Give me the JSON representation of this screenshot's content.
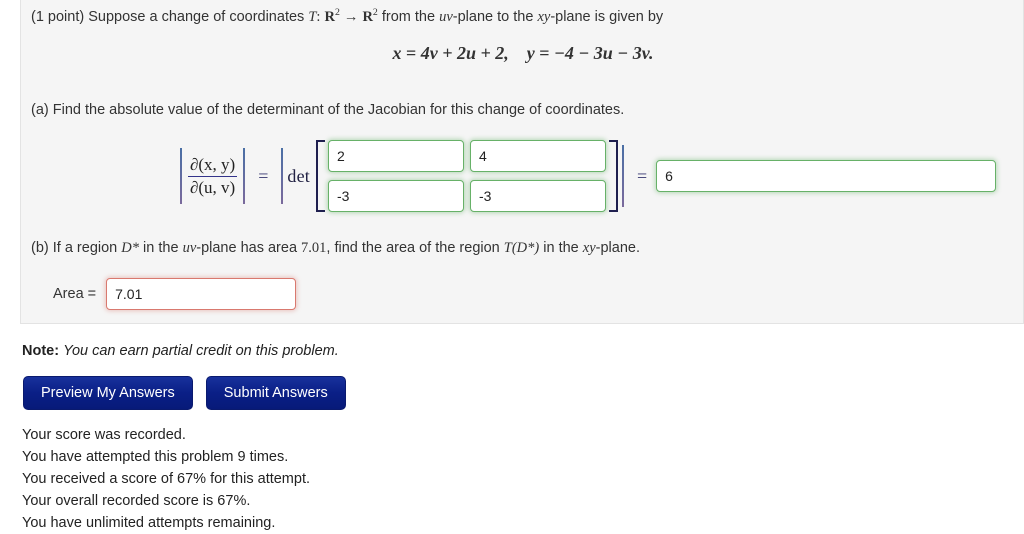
{
  "problem": {
    "points_label": "(1 point)",
    "statement_prefix": "Suppose a change of coordinates",
    "transform_symbol": "T",
    "colon": ":",
    "domain_space": "R",
    "domain_exp": "2",
    "arrow": "→",
    "codomain_space": "R",
    "codomain_exp": "2",
    "statement_mid": "from the",
    "uv_plane": "uv",
    "plane_suffix_1": "-plane to the",
    "xy_plane": "xy",
    "plane_suffix_2": "-plane is given by",
    "display_equation": "x = 4v + 2u + 2,   y = −4 − 3u − 3v.",
    "equation_parts": {
      "x": "x",
      "eq1": "=",
      "x_rhs": "4v + 2u + 2,",
      "y": "y",
      "eq2": "=",
      "y_rhs": "−4 − 3u − 3v."
    }
  },
  "part_a": {
    "label": "(a) Find the absolute value of the determinant of the Jacobian for this change of coordinates.",
    "jacobian": {
      "numerator": "∂(x, y)",
      "denominator": "∂(u, v)",
      "equals_1": "=",
      "det_label": "det",
      "equals_2": "="
    },
    "matrix": {
      "values": [
        "2",
        "4",
        "-3",
        "-3"
      ],
      "states": [
        "correct",
        "correct",
        "correct",
        "correct"
      ]
    },
    "result": {
      "value": "6",
      "state": "correct"
    }
  },
  "part_b": {
    "label_pre": "(b) If a region",
    "d_star": "D*",
    "label_mid1": "in the",
    "uv_plane": "uv",
    "label_mid2": "-plane has area",
    "area_value_text": "7.01",
    "label_mid3": ", find the area of the region",
    "t_d_star": "T(D*)",
    "label_mid4": "in the",
    "xy_plane": "xy",
    "label_end": "-plane.",
    "area_label": "Area =",
    "area_input": {
      "value": "7.01",
      "state": "incorrect"
    }
  },
  "note": {
    "bold_prefix": "Note:",
    "italic_text": "You can earn partial credit on this problem."
  },
  "buttons": {
    "preview": "Preview My Answers",
    "submit": "Submit Answers"
  },
  "score_messages": [
    "Your score was recorded.",
    "You have attempted this problem 9 times.",
    "You received a score of 67% for this attempt.",
    "Your overall recorded score is 67%.",
    "You have unlimited attempts remaining."
  ],
  "colors": {
    "panel_background": "#f5f5f5",
    "correct_border": "#67b168",
    "incorrect_border": "#d9796f",
    "button_background": "#0a1f86",
    "text": "#222222"
  }
}
